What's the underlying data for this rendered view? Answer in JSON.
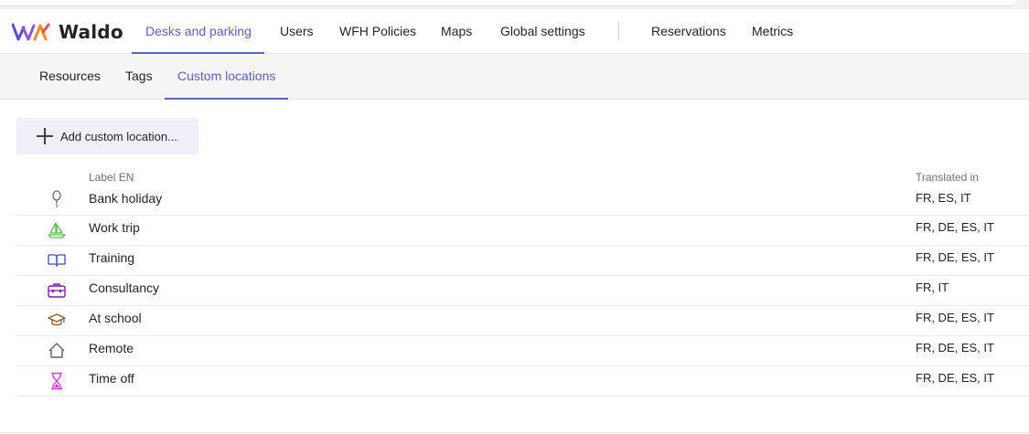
{
  "app": {
    "name": "Waldo"
  },
  "nav": {
    "tabs": [
      {
        "label": "Desks and parking",
        "active": true
      },
      {
        "label": "Users"
      },
      {
        "label": "WFH Policies"
      },
      {
        "label": "Maps"
      },
      {
        "label": "Global settings"
      },
      {
        "label": "Reservations"
      },
      {
        "label": "Metrics"
      }
    ]
  },
  "subnav": {
    "tabs": [
      {
        "label": "Resources"
      },
      {
        "label": "Tags"
      },
      {
        "label": "Custom locations",
        "active": true
      }
    ]
  },
  "toolbar": {
    "add_label": "Add custom location..."
  },
  "table": {
    "headers": {
      "label": "Label EN",
      "translated": "Translated in"
    },
    "rows": [
      {
        "icon": "balloon-icon",
        "color": "#6b6b6b",
        "label": "Bank holiday",
        "translated": "FR, ES, IT"
      },
      {
        "icon": "sailboat-icon",
        "color": "#54c047",
        "label": "Work trip",
        "translated": "FR, DE, ES, IT"
      },
      {
        "icon": "book-icon",
        "color": "#3f51b5",
        "label": "Training",
        "translated": "FR, DE, ES, IT"
      },
      {
        "icon": "briefcase-icon",
        "color": "#7b1fa2",
        "label": "Consultancy",
        "translated": "FR, IT"
      },
      {
        "icon": "graduation-cap-icon",
        "color": "#8d5a2b",
        "label": "At school",
        "translated": "FR, DE, ES, IT"
      },
      {
        "icon": "home-icon",
        "color": "#616161",
        "label": "Remote",
        "translated": "FR, DE, ES, IT"
      },
      {
        "icon": "hourglass-icon",
        "color": "#d63ad6",
        "label": "Time off",
        "translated": "FR, DE, ES, IT"
      }
    ]
  },
  "colors": {
    "accent": "#5b5fc7",
    "button_bg": "#f0effa",
    "subbar_bg": "#f5f5f5"
  }
}
